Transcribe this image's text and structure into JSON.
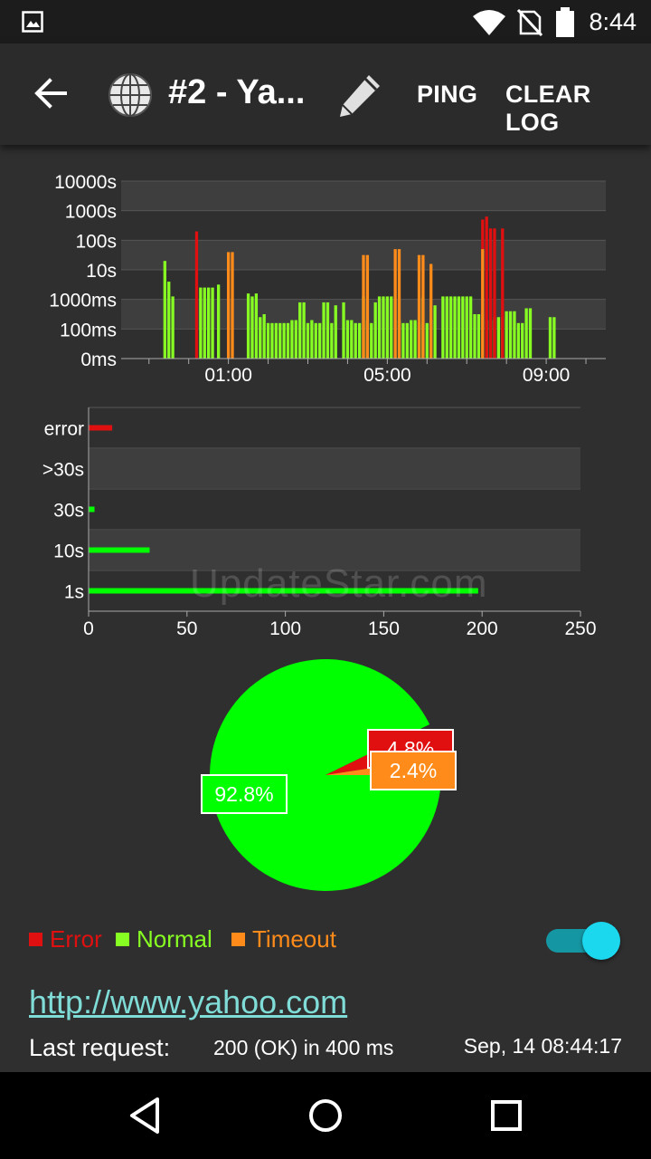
{
  "status_bar": {
    "time": "8:44",
    "icons": [
      "image-icon",
      "wifi-icon",
      "no-sim-icon",
      "battery-icon"
    ]
  },
  "app_bar": {
    "title": "#2 - Ya...",
    "ping_label": "PING",
    "clear_log_label": "CLEAR LOG",
    "icons": [
      "back-arrow-icon",
      "globe-icon",
      "pencil-icon"
    ]
  },
  "watermark": "UpdateStar.com",
  "colors": {
    "error": "#e01010",
    "normal": "#88ff22",
    "timeout": "#ff8c1a",
    "pie_normal": "#00ff00",
    "background": "#2f2f2f"
  },
  "chart_data": [
    {
      "type": "bar",
      "title": "",
      "y_scale": "log",
      "ytick_labels": [
        "0ms",
        "100ms",
        "1000ms",
        "10s",
        "100s",
        "1000s",
        "10000s"
      ],
      "xtick_labels": [
        "01:00",
        "05:00",
        "09:00"
      ],
      "x_unit": "hours",
      "xlim": [
        -1.7,
        10.5
      ],
      "ylim": [
        0,
        6
      ],
      "grid": true,
      "series": [
        {
          "name": "Normal",
          "points": [
            [
              -0.6,
              3.3
            ],
            [
              -0.5,
              2.6
            ],
            [
              -0.4,
              2.1
            ],
            [
              0.3,
              2.4
            ],
            [
              0.4,
              2.4
            ],
            [
              0.5,
              2.4
            ],
            [
              0.6,
              2.4
            ],
            [
              0.75,
              2.5
            ],
            [
              1.5,
              2.2
            ],
            [
              1.6,
              2.1
            ],
            [
              1.7,
              2.2
            ],
            [
              1.8,
              1.4
            ],
            [
              1.9,
              1.5
            ],
            [
              2.0,
              1.2
            ],
            [
              2.1,
              1.2
            ],
            [
              2.2,
              1.2
            ],
            [
              2.3,
              1.2
            ],
            [
              2.4,
              1.2
            ],
            [
              2.5,
              1.2
            ],
            [
              2.6,
              1.3
            ],
            [
              2.7,
              1.3
            ],
            [
              2.8,
              1.9
            ],
            [
              2.9,
              1.9
            ],
            [
              3.0,
              1.2
            ],
            [
              3.1,
              1.3
            ],
            [
              3.2,
              1.2
            ],
            [
              3.3,
              1.2
            ],
            [
              3.4,
              1.9
            ],
            [
              3.5,
              1.9
            ],
            [
              3.6,
              1.2
            ],
            [
              3.7,
              1.8
            ],
            [
              3.9,
              1.9
            ],
            [
              4.0,
              1.3
            ],
            [
              4.1,
              1.3
            ],
            [
              4.2,
              1.2
            ],
            [
              4.3,
              1.2
            ],
            [
              4.4,
              2.1
            ],
            [
              4.5,
              1.3
            ],
            [
              4.6,
              1.2
            ],
            [
              4.7,
              1.9
            ],
            [
              4.8,
              2.1
            ],
            [
              4.9,
              2.1
            ],
            [
              5.0,
              2.1
            ],
            [
              5.1,
              2.1
            ],
            [
              5.3,
              1.3
            ],
            [
              5.4,
              1.2
            ],
            [
              5.5,
              1.2
            ],
            [
              5.6,
              1.3
            ],
            [
              5.7,
              1.3
            ],
            [
              5.8,
              1.2
            ],
            [
              5.9,
              2.1
            ],
            [
              6.0,
              1.2
            ],
            [
              6.1,
              1.3
            ],
            [
              6.2,
              1.8
            ],
            [
              6.4,
              2.1
            ],
            [
              6.5,
              2.1
            ],
            [
              6.6,
              2.1
            ],
            [
              6.7,
              2.1
            ],
            [
              6.8,
              2.1
            ],
            [
              6.9,
              2.1
            ],
            [
              7.0,
              2.1
            ],
            [
              7.1,
              2.1
            ],
            [
              7.2,
              1.5
            ],
            [
              7.3,
              1.5
            ],
            [
              7.4,
              1.5
            ],
            [
              7.5,
              1.3
            ],
            [
              7.6,
              1.3
            ],
            [
              7.7,
              1.4
            ],
            [
              7.8,
              1.4
            ],
            [
              7.9,
              1.4
            ],
            [
              8.0,
              1.6
            ],
            [
              8.1,
              1.6
            ],
            [
              8.2,
              1.6
            ],
            [
              8.3,
              1.2
            ],
            [
              8.4,
              1.2
            ],
            [
              8.5,
              1.7
            ],
            [
              8.6,
              1.7
            ],
            [
              9.1,
              1.4
            ],
            [
              9.2,
              1.4
            ]
          ]
        },
        {
          "name": "Error",
          "points": [
            [
              0.2,
              4.3
            ],
            [
              7.4,
              4.7
            ],
            [
              7.5,
              4.8
            ],
            [
              7.6,
              4.4
            ],
            [
              7.7,
              4.4
            ],
            [
              7.9,
              4.4
            ]
          ]
        },
        {
          "name": "Timeout",
          "points": [
            [
              1.0,
              3.6
            ],
            [
              1.1,
              3.6
            ],
            [
              4.4,
              3.5
            ],
            [
              4.5,
              3.5
            ],
            [
              5.2,
              3.7
            ],
            [
              5.3,
              3.7
            ],
            [
              5.8,
              3.5
            ],
            [
              5.9,
              3.5
            ],
            [
              6.1,
              3.2
            ],
            [
              7.4,
              3.7
            ]
          ]
        }
      ]
    },
    {
      "type": "bar",
      "orientation": "horizontal",
      "categories": [
        "error",
        ">30s",
        "30s",
        "10s",
        "1s"
      ],
      "values": [
        12,
        0,
        3,
        31,
        198
      ],
      "xlim": [
        0,
        250
      ],
      "xtick_labels": [
        "0",
        "50",
        "100",
        "150",
        "200",
        "250"
      ],
      "grid": true
    },
    {
      "type": "pie",
      "slices": [
        {
          "name": "Normal",
          "value": 92.8,
          "label": "92.8%"
        },
        {
          "name": "Error",
          "value": 4.8,
          "label": "4.8%"
        },
        {
          "name": "Timeout",
          "value": 2.4,
          "label": "2.4%"
        }
      ]
    }
  ],
  "legend": {
    "items": [
      {
        "label": "Error",
        "color": "#e01010"
      },
      {
        "label": "Normal",
        "color": "#88ff22"
      },
      {
        "label": "Timeout",
        "color": "#ff8c1a"
      }
    ]
  },
  "toggle": {
    "on": true
  },
  "details": {
    "url": "http://www.yahoo.com",
    "last_request_label": "Last request:",
    "last_request_value": "200 (OK) in 400 ms",
    "last_request_time": "Sep, 14 08:44:17"
  },
  "nav_bar": {
    "icons": [
      "back-triangle-icon",
      "home-circle-icon",
      "recents-square-icon"
    ]
  }
}
